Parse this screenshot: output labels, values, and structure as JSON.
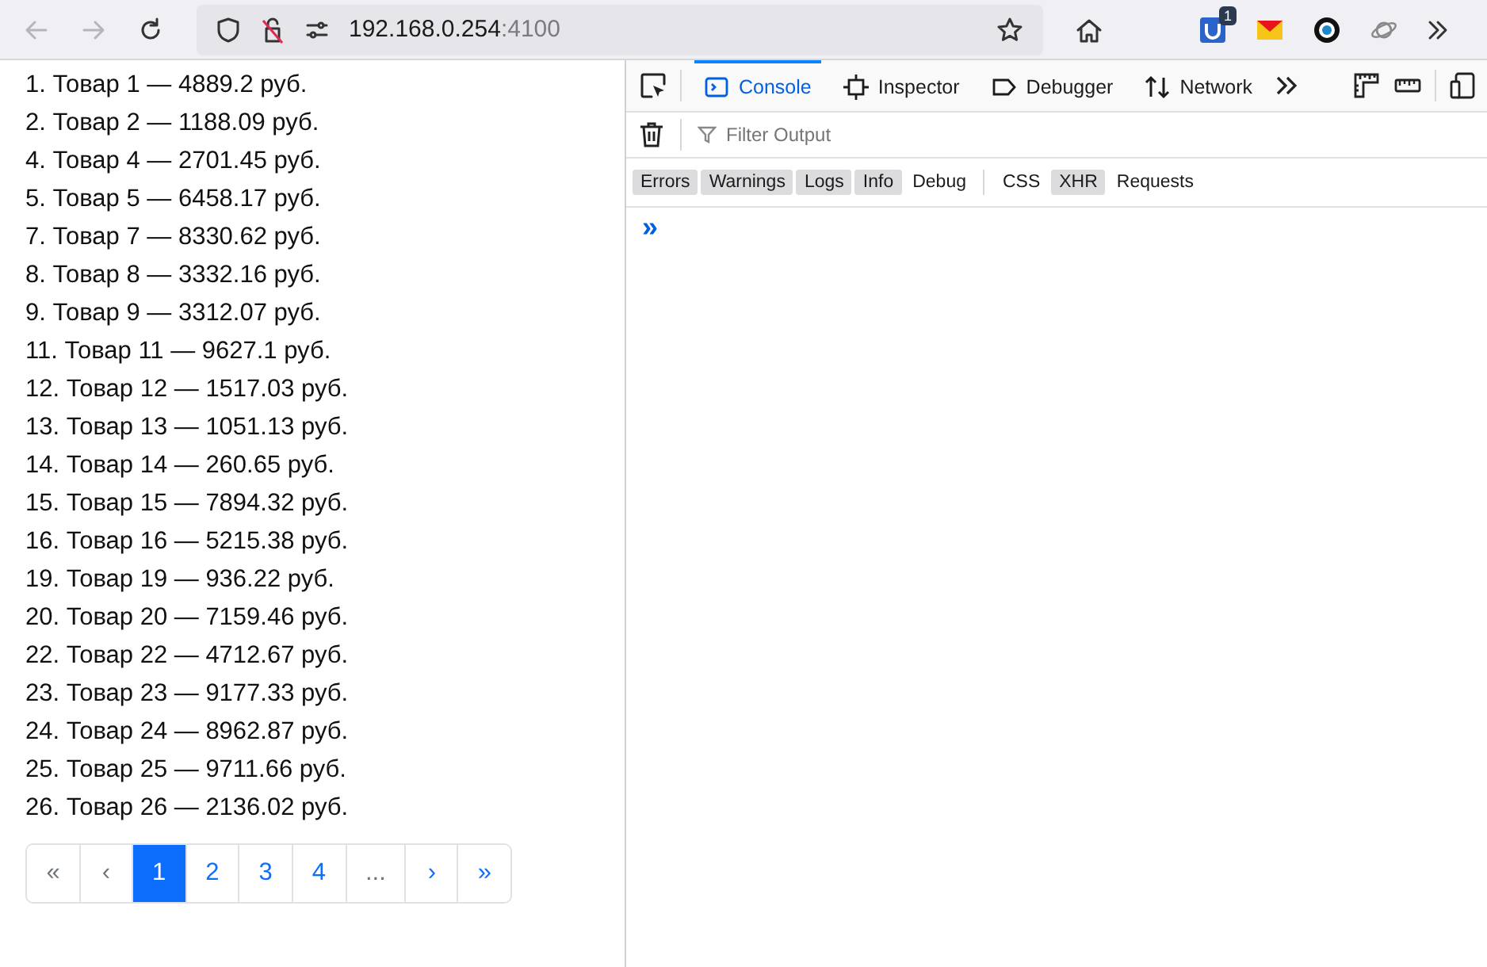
{
  "browser": {
    "back_disabled": true,
    "forward_disabled": true,
    "url_host": "192.168.0.254",
    "url_port": ":4100",
    "extension_badge": "1"
  },
  "items": [
    "1. Товар 1 — 4889.2 руб.",
    "2. Товар 2 — 1188.09 руб.",
    "4. Товар 4 — 2701.45 руб.",
    "5. Товар 5 — 6458.17 руб.",
    "7. Товар 7 — 8330.62 руб.",
    "8. Товар 8 — 3332.16 руб.",
    "9. Товар 9 — 3312.07 руб.",
    "11. Товар 11 — 9627.1 руб.",
    "12. Товар 12 — 1517.03 руб.",
    "13. Товар 13 — 1051.13 руб.",
    "14. Товар 14 — 260.65 руб.",
    "15. Товар 15 — 7894.32 руб.",
    "16. Товар 16 — 5215.38 руб.",
    "19. Товар 19 — 936.22 руб.",
    "20. Товар 20 — 7159.46 руб.",
    "22. Товар 22 — 4712.67 руб.",
    "23. Товар 23 — 9177.33 руб.",
    "24. Товар 24 — 8962.87 руб.",
    "25. Товар 25 — 9711.66 руб.",
    "26. Товар 26 — 2136.02 руб."
  ],
  "pagination": [
    {
      "label": "«",
      "selected": false,
      "disabled": true
    },
    {
      "label": "‹",
      "selected": false,
      "disabled": true
    },
    {
      "label": "1",
      "selected": true,
      "disabled": false
    },
    {
      "label": "2",
      "selected": false,
      "disabled": false
    },
    {
      "label": "3",
      "selected": false,
      "disabled": false
    },
    {
      "label": "4",
      "selected": false,
      "disabled": false
    },
    {
      "label": "...",
      "selected": false,
      "disabled": true
    },
    {
      "label": "›",
      "selected": false,
      "disabled": false
    },
    {
      "label": "»",
      "selected": false,
      "disabled": false
    }
  ],
  "devtools": {
    "tabs": [
      {
        "label": "Console",
        "selected": true
      },
      {
        "label": "Inspector",
        "selected": false
      },
      {
        "label": "Debugger",
        "selected": false
      },
      {
        "label": "Network",
        "selected": false
      }
    ],
    "filter_placeholder": "Filter Output",
    "level_filters": [
      {
        "label": "Errors",
        "selected": true
      },
      {
        "label": "Warnings",
        "selected": true
      },
      {
        "label": "Logs",
        "selected": true
      },
      {
        "label": "Info",
        "selected": true
      },
      {
        "label": "Debug",
        "selected": false
      }
    ],
    "type_filters": [
      {
        "label": "CSS",
        "selected": false
      },
      {
        "label": "XHR",
        "selected": true
      },
      {
        "label": "Requests",
        "selected": false
      }
    ],
    "prompt": "»"
  }
}
